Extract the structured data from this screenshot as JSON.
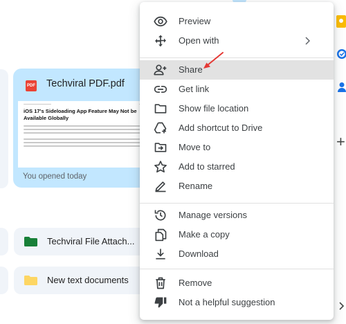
{
  "file_card": {
    "badge": "PDF",
    "title": "Techviral PDF.pdf",
    "thumbnail_headline": "iOS 17's Sideloading App Feature May Not be Available Globally",
    "subtitle": "You opened today"
  },
  "file_rows": [
    {
      "label": "Techviral File Attach...",
      "icon": "folder-icon",
      "color": "#188038"
    },
    {
      "label": "New text documents",
      "icon": "folder-icon",
      "color": "#fdd663"
    }
  ],
  "menu": {
    "items": [
      {
        "label": "Preview",
        "icon": "eye-icon"
      },
      {
        "label": "Open with",
        "icon": "move-arrows-icon",
        "has_submenu": true
      },
      {
        "label": "Share",
        "icon": "person-add-icon",
        "highlighted": true
      },
      {
        "label": "Get link",
        "icon": "link-icon"
      },
      {
        "label": "Show file location",
        "icon": "folder-outline-icon"
      },
      {
        "label": "Add shortcut to Drive",
        "icon": "add-to-drive-icon"
      },
      {
        "label": "Move to",
        "icon": "drive-file-move-icon"
      },
      {
        "label": "Add to starred",
        "icon": "star-outline-icon"
      },
      {
        "label": "Rename",
        "icon": "pencil-icon"
      },
      {
        "label": "Manage versions",
        "icon": "history-icon"
      },
      {
        "label": "Make a copy",
        "icon": "copy-icon"
      },
      {
        "label": "Download",
        "icon": "download-icon"
      },
      {
        "label": "Remove",
        "icon": "trash-icon"
      },
      {
        "label": "Not a helpful suggestion",
        "icon": "thumb-down-icon"
      }
    ]
  },
  "right_rail": {
    "icons": [
      "keep-icon",
      "tasks-icon",
      "contacts-icon",
      "add-icon",
      "chevron-right-icon"
    ]
  },
  "colors": {
    "card_selected": "#c2e7ff",
    "card_bg": "#f0f4f9",
    "menu_highlight": "#e2e2e2",
    "pdf_red": "#ea4335",
    "annotation_arrow": "#e53935",
    "text_primary": "#3c4043"
  }
}
